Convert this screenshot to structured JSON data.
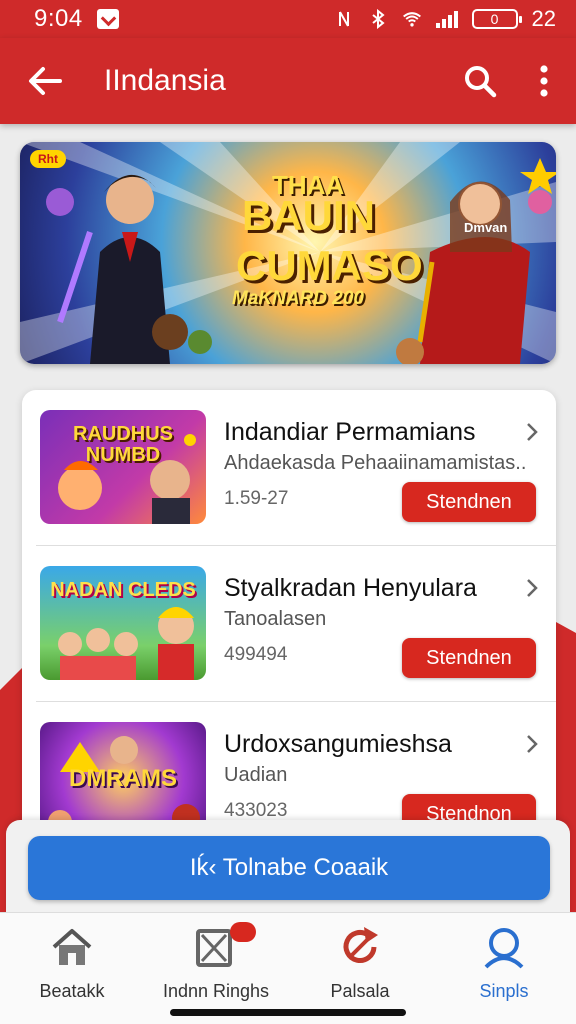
{
  "status_bar": {
    "time": "9:04",
    "battery_level": "0",
    "battery_percent": "22"
  },
  "app_bar": {
    "title": "IIndansia"
  },
  "banner": {
    "logo": "Rht",
    "line1": "THAA",
    "line2": "BAUIN",
    "line3": "CUMASO",
    "line4": "MaKNARD 200",
    "badge": "Dmvan"
  },
  "list": [
    {
      "thumb_text": "RAUDHUS NUMBD",
      "title": "Indandiar Permamians",
      "subtitle": "Ahdaekasda Pehaaiinamamistas..",
      "number": "1.59-27",
      "button_label": "Stendnen"
    },
    {
      "thumb_text": "NADAN CLEDS",
      "title": "Styalkradan Henyulara",
      "subtitle": "Tanoalasen",
      "number": "499494",
      "button_label": "Stendnen"
    },
    {
      "thumb_text": "DMRAMS",
      "title": "Urdoxsangumieshsa",
      "subtitle": "Uadian",
      "number": "433023",
      "button_label": "Stendnon"
    }
  ],
  "action_button": {
    "label": "Iḱ‹ Tolnabe Coaaik"
  },
  "bottom_nav": [
    {
      "label": "Beatakk",
      "icon": "home-icon"
    },
    {
      "label": "Indnn Ringhs",
      "icon": "inbox-icon"
    },
    {
      "label": "Palsala",
      "icon": "refresh-icon"
    },
    {
      "label": "Sinpls",
      "icon": "profile-icon",
      "active": true
    }
  ],
  "colors": {
    "primary": "#cf2a2a",
    "button_red": "#d7281f",
    "action_blue": "#2a76d8",
    "active_nav": "#2a6fcf"
  }
}
